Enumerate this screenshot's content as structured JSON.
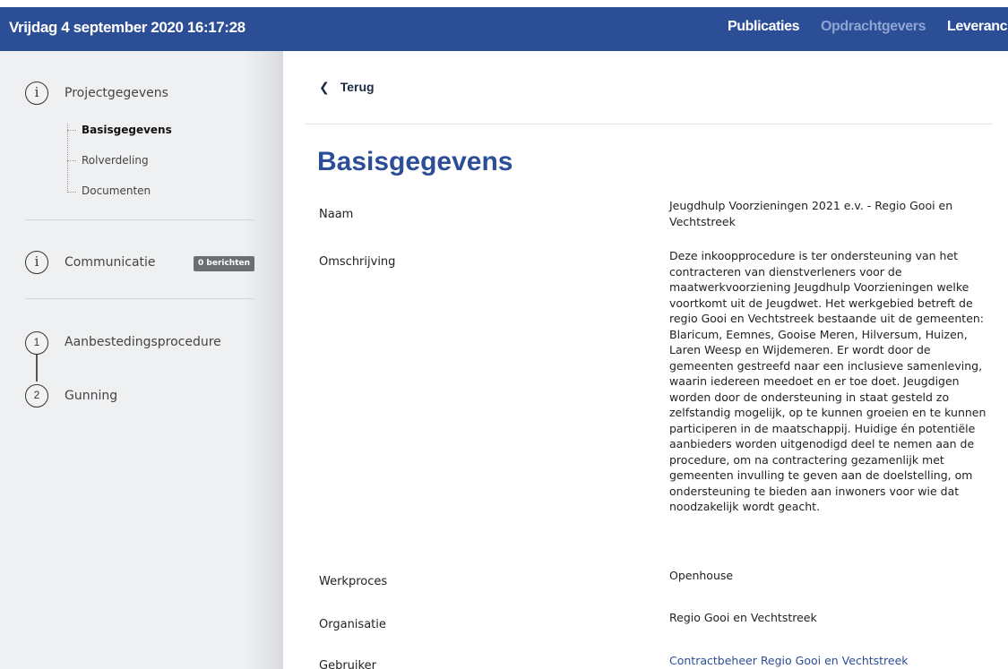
{
  "topbar": {
    "datetime": "Vrijdag 4 september 2020 16:17:28",
    "nav": [
      "Publicaties",
      "Opdrachtgevers",
      "Leveranci"
    ]
  },
  "sidebar": {
    "project_title": "Projectgegevens",
    "sub_items": [
      "Basisgegevens",
      "Rolverdeling",
      "Documenten"
    ],
    "communicatie": "Communicatie",
    "badge": "0 berichten",
    "steps": [
      {
        "number": "1",
        "label": "Aanbestedingsprocedure"
      },
      {
        "number": "2",
        "label": "Gunning"
      }
    ]
  },
  "main": {
    "back_label": "Terug",
    "title": "Basisgegevens",
    "fields": [
      {
        "label": "Naam",
        "value": "Jeugdhulp Voorzieningen 2021 e.v. - Regio Gooi en Vechtstreek"
      },
      {
        "label": "Omschrijving",
        "value": "Deze inkoopprocedure is ter ondersteuning van het contracteren van dienstverleners voor de maatwerkvoorziening Jeugdhulp Voorzieningen welke voortkomt uit de Jeugdwet. Het werkgebied betreft de regio Gooi en Vechtstreek bestaande uit de gemeenten: Blaricum, Eemnes, Gooise Meren, Hilversum, Huizen, Laren Weesp en Wijdemeren. Er wordt door de gemeenten gestreefd naar een inclusieve samenleving, waarin iedereen meedoet en er toe doet. Jeugdigen worden door de ondersteuning in staat gesteld zo zelfstandig mogelijk, op te kunnen groeien en te kunnen participeren in de maatschappij. Huidige én potentiële aanbieders worden uitgenodigd deel te nemen aan de procedure, om na contractering gezamenlijk met gemeenten invulling te geven aan de doelstelling, om ondersteuning te bieden aan inwoners voor wie dat noodzakelijk wordt geacht."
      },
      {
        "label": "Werkproces",
        "value": "Openhouse"
      },
      {
        "label": "Organisatie",
        "value": "Regio Gooi en Vechtstreek"
      },
      {
        "label": "Gebruiker",
        "value": "Contractbeheer Regio Gooi en Vechtstreek"
      }
    ]
  },
  "colors": {
    "brand": "#2c4e97",
    "sidebar_bg": "#eef0f2",
    "badge_bg": "#6b6e72"
  },
  "icons": [
    "info-icon",
    "chevron-left-icon"
  ]
}
